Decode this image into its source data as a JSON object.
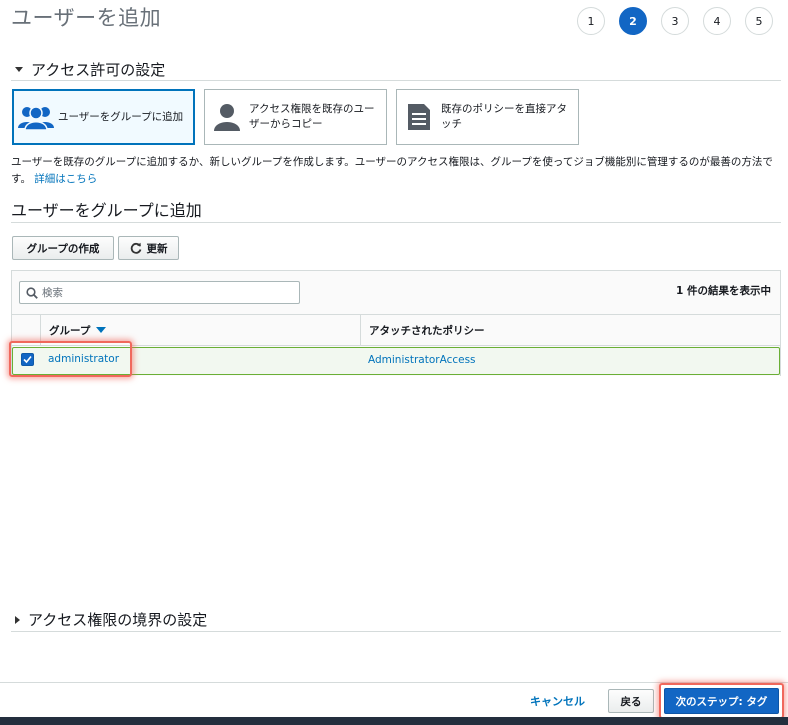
{
  "page": {
    "title": "ユーザーを追加"
  },
  "steps": [
    "1",
    "2",
    "3",
    "4",
    "5"
  ],
  "active_step": 2,
  "permissions_section": {
    "heading": "アクセス許可の設定",
    "options": [
      {
        "label": "ユーザーをグループに追加",
        "icon": "user-group-icon",
        "selected": true
      },
      {
        "label": "アクセス権限を既存のユーザーからコピー",
        "icon": "user-icon",
        "selected": false
      },
      {
        "label": "既存のポリシーを直接アタッチ",
        "icon": "document-icon",
        "selected": false
      }
    ],
    "description": "ユーザーを既存のグループに追加するか、新しいグループを作成します。ユーザーのアクセス権限は、グループを使ってジョブ機能別に管理するのが最善の方法です。",
    "details_link": "詳細はこちら"
  },
  "groups_section": {
    "heading": "ユーザーをグループに追加",
    "create_group_button": "グループの作成",
    "refresh_button": "更新",
    "search_placeholder": "検索",
    "result_count": "1 件の結果を表示中",
    "columns": [
      "グループ",
      "アタッチされたポリシー"
    ],
    "rows": [
      {
        "checked": true,
        "group": "administrator",
        "policy": "AdministratorAccess"
      }
    ]
  },
  "boundary_section": {
    "heading": "アクセス権限の境界の設定"
  },
  "footer": {
    "cancel": "キャンセル",
    "back": "戻る",
    "next": "次のステップ: タグ"
  },
  "colors": {
    "accent": "#1266c4",
    "link": "#0073bb",
    "selected_row_border": "#6aaf35",
    "highlight": "#f0685c"
  }
}
